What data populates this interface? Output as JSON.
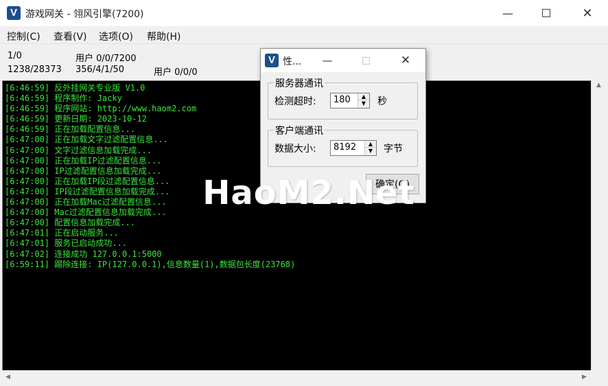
{
  "window": {
    "title": "游戏网关 - 翎风引擎(7200)",
    "icon_letter": "V",
    "minimize_glyph": "—",
    "close_glyph": "✕"
  },
  "menu": [
    "控制(C)",
    "查看(V)",
    "选项(O)",
    "帮助(H)"
  ],
  "stats": {
    "row1_a": "1/0",
    "row1_b": "用户 0/0/7200",
    "row2_a": "1238/28373",
    "row2_b": "356/4/1/50",
    "row2_c": "用户 0/0/0"
  },
  "log": [
    {
      "time": "[6:46:59]",
      "msg": " 反外挂网关专业版 V1.0"
    },
    {
      "time": "[6:46:59]",
      "msg": " 程序制作: Jacky"
    },
    {
      "time": "[6:46:59]",
      "msg": " 程序网站: http://www.haom2.com"
    },
    {
      "time": "[6:46:59]",
      "msg": " 更新日期: 2023-10-12"
    },
    {
      "time": "[6:46:59]",
      "msg": " 正在加载配置信息..."
    },
    {
      "time": "[6:47:00]",
      "msg": " 正在加载文字过滤配置信息..."
    },
    {
      "time": "[6:47:00]",
      "msg": " 文字过滤信息加载完成..."
    },
    {
      "time": "[6:47:00]",
      "msg": " 正在加载IP过滤配置信息..."
    },
    {
      "time": "[6:47:00]",
      "msg": " IP过滤配置信息加载完成..."
    },
    {
      "time": "[6:47:00]",
      "msg": " 正在加载IP段过滤配置信息..."
    },
    {
      "time": "[6:47:00]",
      "msg": " IP段过滤配置信息加载完成..."
    },
    {
      "time": "[6:47:00]",
      "msg": " 正在加载Mac过滤配置信息..."
    },
    {
      "time": "[6:47:00]",
      "msg": " Mac过滤配置信息加载完成..."
    },
    {
      "time": "[6:47:00]",
      "msg": " 配置信息加载完成..."
    },
    {
      "time": "[6:47:01]",
      "msg": " 正在启动服务..."
    },
    {
      "time": "[6:47:01]",
      "msg": " 服务已启动成功..."
    },
    {
      "time": "[6:47:02]",
      "msg": " 连接成功 127.0.0.1:5000"
    },
    {
      "time": "[6:59:11]",
      "msg": " 踢除连接: IP(127.0.0.1),信息数量(1),数据包长度(23768)"
    }
  ],
  "dialog": {
    "title": "性...",
    "server_group": "服务器通讯",
    "timeout_label": "检测超时:",
    "timeout_value": "180",
    "timeout_unit": "秒",
    "client_group": "客户端通讯",
    "size_label": "数据大小:",
    "size_value": "8192",
    "size_unit": "字节",
    "ok_label": "确定(O)",
    "spin_up": "▲",
    "spin_down": "▼"
  },
  "watermark": "HaoM2.Net",
  "scroll_arrows": {
    "up": "▲",
    "down": "▼",
    "left": "◀",
    "right": "▶"
  }
}
